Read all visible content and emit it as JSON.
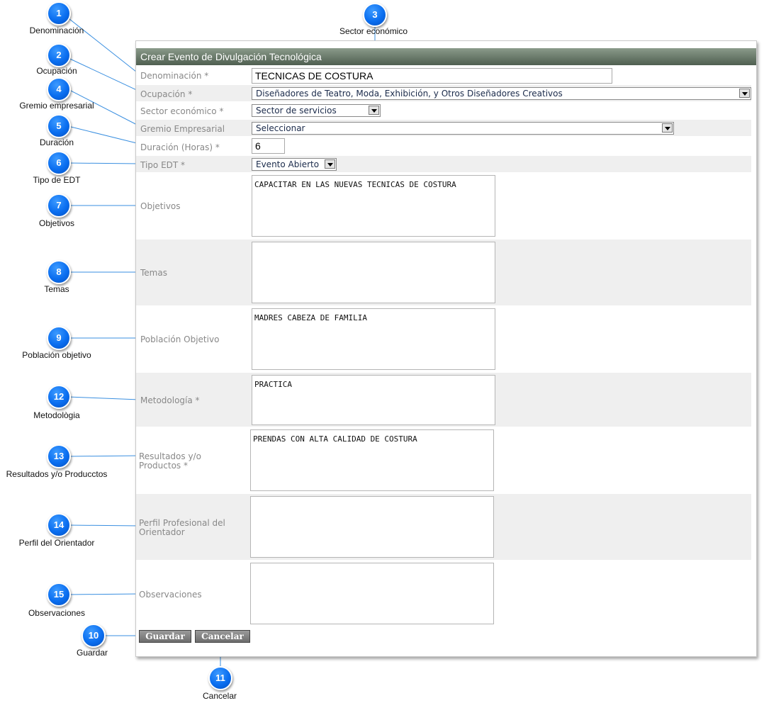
{
  "form": {
    "title": "Crear Evento de Divulgación Tecnológica",
    "denominacion": {
      "label": "Denominación *",
      "value": "TECNICAS DE COSTURA"
    },
    "ocupacion": {
      "label": "Ocupación *",
      "value": "Diseñadores de Teatro, Moda, Exhibición, y Otros Diseñadores Creativos"
    },
    "sector": {
      "label": "Sector económico *",
      "value": "Sector de servicios"
    },
    "gremio": {
      "label": "Gremio Empresarial",
      "value": "Seleccionar"
    },
    "duracion": {
      "label": "Duración (Horas) *",
      "value": "6"
    },
    "tipo": {
      "label": "Tipo EDT *",
      "value": "Evento Abierto"
    },
    "objetivos": {
      "label": "Objetivos",
      "value": "CAPACITAR EN LAS NUEVAS TECNICAS DE COSTURA"
    },
    "temas": {
      "label": "Temas",
      "value": ""
    },
    "poblacion": {
      "label": "Población Objetivo",
      "value": "MADRES CABEZA DE FAMILIA"
    },
    "metodologia": {
      "label": "Metodología *",
      "value": "PRACTICA"
    },
    "resultados": {
      "label": "Resultados y/o Productos *",
      "value": "PRENDAS CON ALTA CALIDAD DE COSTURA"
    },
    "perfil": {
      "label": "Perfil Profesional del Orientador",
      "value": ""
    },
    "observaciones": {
      "label": "Observaciones",
      "value": ""
    },
    "guardar_label": "Guardar",
    "cancelar_label": "Cancelar"
  },
  "callouts": [
    {
      "number": "1",
      "label": "Denominación"
    },
    {
      "number": "2",
      "label": "Ocupación"
    },
    {
      "number": "3",
      "label": "Sector económico"
    },
    {
      "number": "4",
      "label": "Gremio empresarial"
    },
    {
      "number": "5",
      "label": "Duración"
    },
    {
      "number": "6",
      "label": "Tipo de EDT"
    },
    {
      "number": "7",
      "label": "Objetivos"
    },
    {
      "number": "8",
      "label": "Temas"
    },
    {
      "number": "9",
      "label": "Población objetivo"
    },
    {
      "number": "12",
      "label": "Metodològia"
    },
    {
      "number": "13",
      "label": "Resultados y/o Producctos"
    },
    {
      "number": "14",
      "label": "Perfil del Orientador"
    },
    {
      "number": "15",
      "label": "Observaciones"
    },
    {
      "number": "10",
      "label": "Guardar"
    },
    {
      "number": "11",
      "label": "Cancelar"
    }
  ]
}
